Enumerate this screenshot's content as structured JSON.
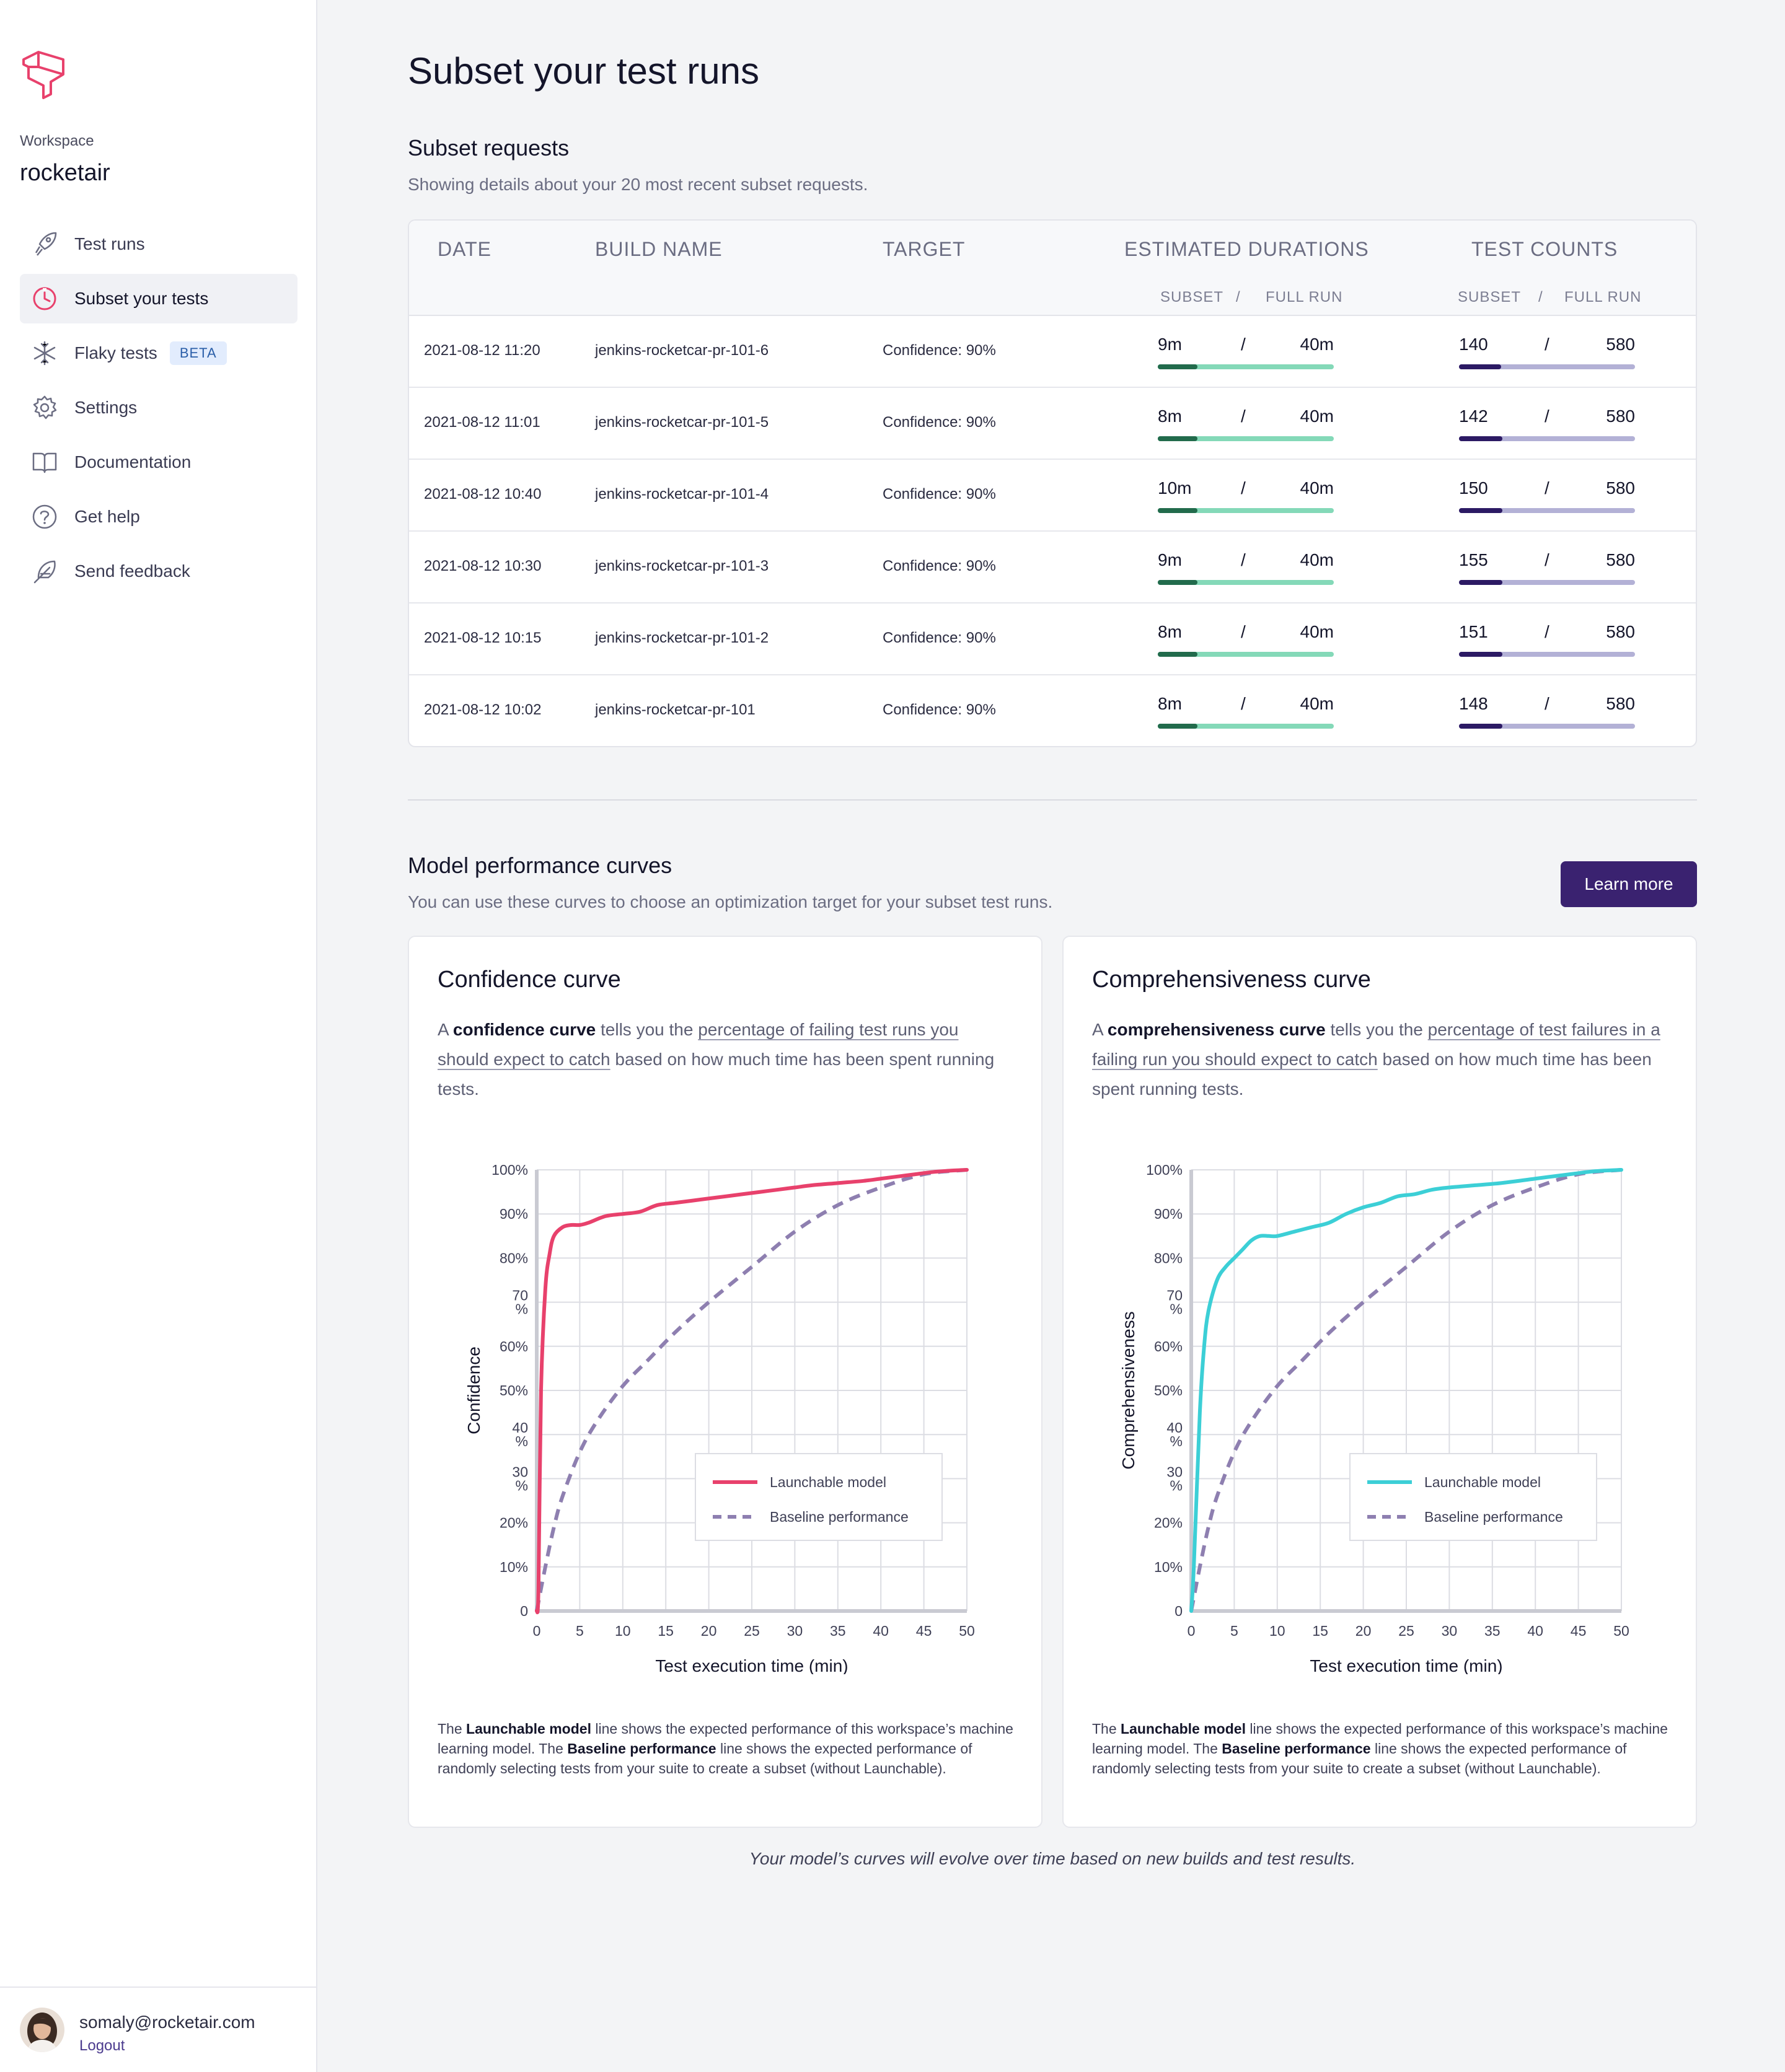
{
  "sidebar": {
    "workspace_label": "Workspace",
    "workspace_name": "rocketair",
    "items": [
      {
        "label": "Test runs",
        "icon": "rocket-icon",
        "active": false
      },
      {
        "label": "Subset your tests",
        "icon": "stopwatch-icon",
        "active": true
      },
      {
        "label": "Flaky tests",
        "icon": "snowflake-icon",
        "badge": "BETA",
        "active": false
      },
      {
        "label": "Settings",
        "icon": "gear-icon",
        "active": false
      },
      {
        "label": "Documentation",
        "icon": "book-icon",
        "active": false
      },
      {
        "label": "Get help",
        "icon": "question-icon",
        "active": false
      },
      {
        "label": "Send feedback",
        "icon": "feather-icon",
        "active": false
      }
    ],
    "user": {
      "email": "somaly@rocketair.com",
      "logout_label": "Logout"
    }
  },
  "page": {
    "title": "Subset your test runs"
  },
  "subset_requests": {
    "title": "Subset requests",
    "subtitle": "Showing details about your 20 most recent subset requests.",
    "columns": {
      "date": "DATE",
      "build_name": "BUILD NAME",
      "target": "TARGET",
      "estimated_durations": "ESTIMATED DURATIONS",
      "test_counts": "TEST COUNTS",
      "subset": "SUBSET",
      "sep": "/",
      "full_run": "FULL RUN"
    },
    "rows": [
      {
        "date": "2021-08-12 11:20",
        "build": "jenkins-rocketcar-pr-101-6",
        "target": "Confidence: 90%",
        "dur_subset": "9m",
        "dur_full": "40m",
        "dur_ratio": 0.225,
        "count_subset": "140",
        "count_full": "580",
        "count_ratio": 0.241
      },
      {
        "date": "2021-08-12 11:01",
        "build": "jenkins-rocketcar-pr-101-5",
        "target": "Confidence: 90%",
        "dur_subset": "8m",
        "dur_full": "40m",
        "dur_ratio": 0.225,
        "count_subset": "142",
        "count_full": "580",
        "count_ratio": 0.245
      },
      {
        "date": "2021-08-12 10:40",
        "build": "jenkins-rocketcar-pr-101-4",
        "target": "Confidence: 90%",
        "dur_subset": "10m",
        "dur_full": "40m",
        "dur_ratio": 0.225,
        "count_subset": "150",
        "count_full": "580",
        "count_ratio": 0.245
      },
      {
        "date": "2021-08-12 10:30",
        "build": "jenkins-rocketcar-pr-101-3",
        "target": "Confidence: 90%",
        "dur_subset": "9m",
        "dur_full": "40m",
        "dur_ratio": 0.225,
        "count_subset": "155",
        "count_full": "580",
        "count_ratio": 0.245
      },
      {
        "date": "2021-08-12 10:15",
        "build": "jenkins-rocketcar-pr-101-2",
        "target": "Confidence: 90%",
        "dur_subset": "8m",
        "dur_full": "40m",
        "dur_ratio": 0.225,
        "count_subset": "151",
        "count_full": "580",
        "count_ratio": 0.245
      },
      {
        "date": "2021-08-12 10:02",
        "build": "jenkins-rocketcar-pr-101",
        "target": "Confidence: 90%",
        "dur_subset": "8m",
        "dur_full": "40m",
        "dur_ratio": 0.225,
        "count_subset": "148",
        "count_full": "580",
        "count_ratio": 0.245
      }
    ]
  },
  "model": {
    "title": "Model performance curves",
    "subtitle": "You can use these curves to choose an optimization target for your subset test runs.",
    "learn_more": "Learn more",
    "footnote": "Your model’s curves will evolve over time based on new builds and test results."
  },
  "cards": [
    {
      "title": "Confidence curve",
      "desc_prefix": "A ",
      "desc_bold": "confidence curve",
      "desc_mid": " tells you the ",
      "desc_link": "percentage of failing test runs you should expect to catch",
      "desc_suffix": " based on how much time has been spent running tests.",
      "note_1": "The ",
      "note_b1": "Launchable model",
      "note_2": " line shows the expected performance of this workspace’s machine learning model. The ",
      "note_b2": "Baseline performance",
      "note_3": " line shows the expected performance of randomly selecting tests from your suite to create a subset (without Launchable)."
    },
    {
      "title": "Comprehensiveness curve",
      "desc_prefix": "A ",
      "desc_bold": "comprehensiveness curve",
      "desc_mid": " tells you the ",
      "desc_link": "percentage of test failures in a failing run you should expect to catch",
      "desc_suffix": " based on how much time has been spent running tests.",
      "note_1": "The ",
      "note_b1": "Launchable model",
      "note_2": " line shows the expected performance of this workspace’s machine learning model. The ",
      "note_b2": "Baseline performance",
      "note_3": " line shows the expected performance of randomly selecting tests from your suite to create a subset (without Launchable)."
    }
  ],
  "chart_data": [
    {
      "type": "line",
      "xlabel": "Test execution time (min)",
      "ylabel": "Confidence",
      "xlim": [
        0,
        50
      ],
      "ylim": [
        0,
        100
      ],
      "x_ticks": [
        "0",
        "5",
        "10",
        "15",
        "20",
        "25",
        "30",
        "35",
        "40",
        "45",
        "50"
      ],
      "y_ticks": [
        "0",
        "10%",
        "20%",
        "30\n%",
        "40\n%",
        "50%",
        "60%",
        "70\n%",
        "80%",
        "90%",
        "100%"
      ],
      "grid": true,
      "legend_position": "bottom-right",
      "colors": {
        "model": "#e8416c",
        "baseline": "#8e7fb0"
      },
      "series": [
        {
          "name": "Launchable model",
          "style": "solid",
          "x": [
            0,
            0.2,
            0.5,
            1,
            1.5,
            2,
            3,
            4,
            5,
            6,
            8,
            10,
            12,
            14,
            16,
            18,
            20,
            22,
            24,
            26,
            28,
            30,
            32,
            35,
            38,
            40,
            42,
            44,
            46,
            48,
            50
          ],
          "y": [
            0,
            5,
            50,
            73,
            81,
            85,
            87,
            87.5,
            87.5,
            88,
            89.5,
            90,
            90.5,
            92,
            92.5,
            93,
            93.5,
            94,
            94.5,
            95,
            95.5,
            96,
            96.5,
            97,
            97.5,
            98,
            98.5,
            99,
            99.5,
            99.8,
            100
          ]
        },
        {
          "name": "Baseline performance",
          "style": "dashed",
          "x": [
            0,
            1,
            2,
            3,
            5,
            7,
            10,
            13,
            16,
            20,
            25,
            30,
            35,
            40,
            45,
            50
          ],
          "y": [
            0,
            10,
            19,
            26,
            36,
            43,
            51,
            57,
            63,
            70,
            78,
            86,
            92,
            96,
            99,
            100
          ]
        }
      ]
    },
    {
      "type": "line",
      "xlabel": "Test execution time (min)",
      "ylabel": "Comprehensiveness",
      "xlim": [
        0,
        50
      ],
      "ylim": [
        0,
        100
      ],
      "x_ticks": [
        "0",
        "5",
        "10",
        "15",
        "20",
        "25",
        "30",
        "35",
        "40",
        "45",
        "50"
      ],
      "y_ticks": [
        "0",
        "10%",
        "20%",
        "30\n%",
        "40\n%",
        "50%",
        "60%",
        "70\n%",
        "80%",
        "90%",
        "100%"
      ],
      "grid": true,
      "legend_position": "bottom-right",
      "colors": {
        "model": "#3ccfd6",
        "baseline": "#8e7fb0"
      },
      "series": [
        {
          "name": "Launchable model",
          "style": "solid",
          "x": [
            0,
            0.3,
            1,
            1.5,
            2,
            3,
            4,
            5,
            6,
            7,
            8,
            9,
            10,
            12,
            14,
            16,
            18,
            20,
            22,
            24,
            26,
            28,
            30,
            33,
            36,
            40,
            44,
            47,
            50
          ],
          "y": [
            0,
            10,
            45,
            60,
            68,
            75,
            78,
            80,
            82,
            84,
            85,
            85,
            85,
            86,
            87,
            88,
            90,
            91.5,
            92.5,
            94,
            94.5,
            95.5,
            96,
            96.5,
            97,
            98,
            99,
            99.7,
            100
          ]
        },
        {
          "name": "Baseline performance",
          "style": "dashed",
          "x": [
            0,
            1,
            2,
            3,
            5,
            7,
            10,
            13,
            16,
            20,
            25,
            30,
            35,
            40,
            45,
            50
          ],
          "y": [
            0,
            10,
            19,
            26,
            36,
            43,
            51,
            57,
            63,
            70,
            78,
            86,
            92,
            96,
            99,
            100
          ]
        }
      ]
    }
  ]
}
